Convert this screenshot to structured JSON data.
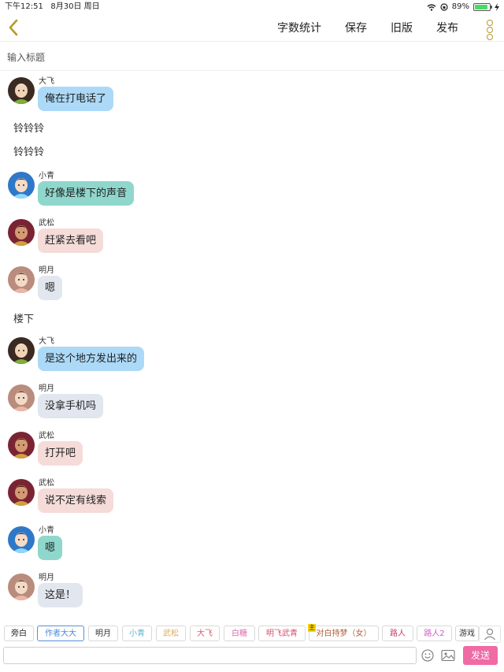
{
  "status_bar": {
    "time": "下午12:51",
    "date": "8月30日 周日",
    "battery": "89%",
    "battery_level": 0.89
  },
  "nav": {
    "word_count": "字数统计",
    "save": "保存",
    "old_version": "旧版",
    "publish": "发布"
  },
  "title_input": {
    "placeholder": "输入标题"
  },
  "messages": [
    {
      "speaker": "大飞",
      "text": "俺在打电话了"
    },
    {
      "narration": "铃铃铃"
    },
    {
      "narration": "铃铃铃"
    },
    {
      "speaker": "小青",
      "text": "好像是楼下的声音"
    },
    {
      "speaker": "武松",
      "text": "赶紧去看吧"
    },
    {
      "speaker": "明月",
      "text": "嗯"
    },
    {
      "narration": "楼下"
    },
    {
      "speaker": "大飞",
      "text": "是这个地方发出来的"
    },
    {
      "speaker": "明月",
      "text": "没拿手机吗"
    },
    {
      "speaker": "武松",
      "text": "打开吧"
    },
    {
      "speaker": "武松",
      "text": "说不定有线索"
    },
    {
      "speaker": "小青",
      "text": "嗯"
    },
    {
      "speaker": "明月",
      "text": "这是！"
    }
  ],
  "characters": [
    {
      "label": "旁白",
      "color": "#222222"
    },
    {
      "label": "作者大大",
      "color": "#4a87d6",
      "selected": true
    },
    {
      "label": "明月",
      "color": "#333333"
    },
    {
      "label": "小青",
      "color": "#5fb7c9"
    },
    {
      "label": "武松",
      "color": "#e0a85a"
    },
    {
      "label": "大飞",
      "color": "#e0566a"
    },
    {
      "label": "白糖",
      "color": "#d86aa7"
    },
    {
      "label": "明飞武青",
      "color": "#d64f6f"
    },
    {
      "label": "对白持梦（女）",
      "color": "#b05d3a",
      "badge": "主"
    },
    {
      "label": "路人",
      "color": "#c43a63"
    },
    {
      "label": "路人2",
      "color": "#cf58c8"
    },
    {
      "label": "游戏",
      "color": "#333333"
    }
  ],
  "compose": {
    "send": "发送"
  },
  "icons": {
    "back": "chevron-left-icon",
    "more": "vertical-dots-icon",
    "emoji": "smiley-icon",
    "image": "image-icon",
    "user": "user-icon",
    "wifi": "wifi-icon",
    "lock": "rotation-lock-icon",
    "charging": "charging-bolt-icon"
  },
  "colors": {
    "accent": "#b59a2a",
    "send_button": "#f06aa5"
  }
}
